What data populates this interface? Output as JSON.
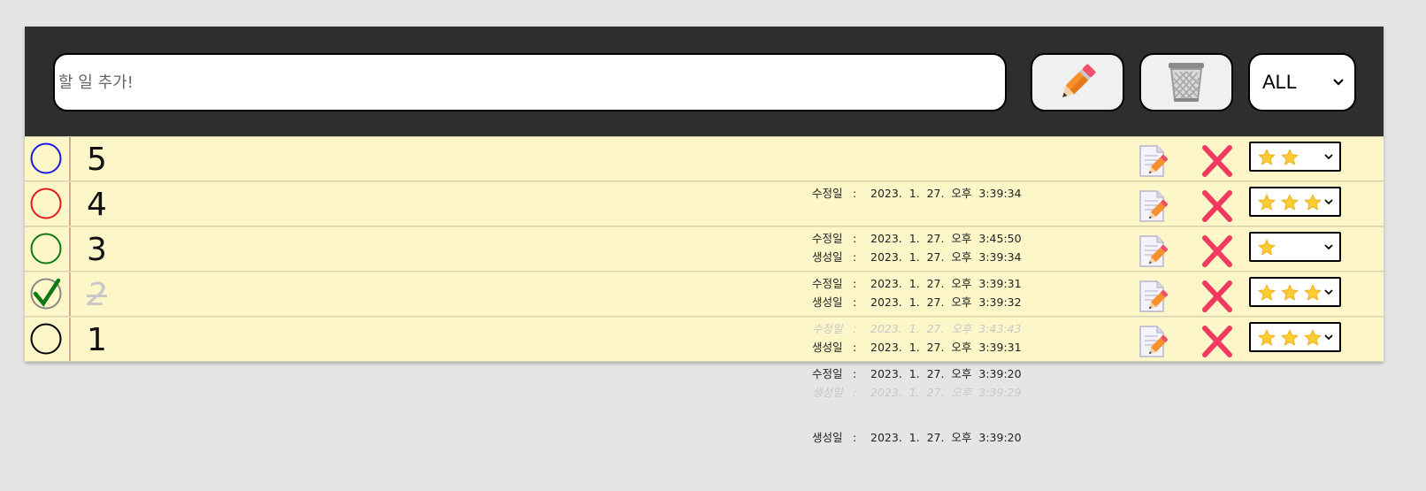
{
  "header": {
    "input_placeholder": "할 일 추가!",
    "input_value": "",
    "add_icon": "pencil-icon",
    "clear_icon": "trash-icon",
    "filter_value": "ALL"
  },
  "labels": {
    "modified": "수정일",
    "created": "생성일",
    "sep": ":"
  },
  "colors": {
    "header_bg": "#2e2e2e",
    "row_bg": "#fcf6c8",
    "delete": "#f03a5f",
    "star": "#fdcb32"
  },
  "todos": [
    {
      "title": "5",
      "checked": false,
      "circle_color": "#1a1ae6",
      "modified": "2023. 1. 27. 오후 3:39:34",
      "created": "2023. 1. 27. 오후 3:39:34",
      "priority": 2
    },
    {
      "title": "4",
      "checked": false,
      "circle_color": "#e61a1a",
      "modified": "2023. 1. 27. 오후 3:45:50",
      "created": "2023. 1. 27. 오후 3:39:32",
      "priority": 3
    },
    {
      "title": "3",
      "checked": false,
      "circle_color": "#117a11",
      "modified": "2023. 1. 27. 오후 3:39:31",
      "created": "2023. 1. 27. 오후 3:39:31",
      "priority": 1
    },
    {
      "title": "2",
      "checked": true,
      "circle_color": "#888888",
      "modified": "2023. 1. 27. 오후 3:43:43",
      "created": "2023. 1. 27. 오후 3:39:29",
      "priority": 3
    },
    {
      "title": "1",
      "checked": false,
      "circle_color": "#000000",
      "modified": "2023. 1. 27. 오후 3:39:20",
      "created": "2023. 1. 27. 오후 3:39:20",
      "priority": 3
    }
  ]
}
